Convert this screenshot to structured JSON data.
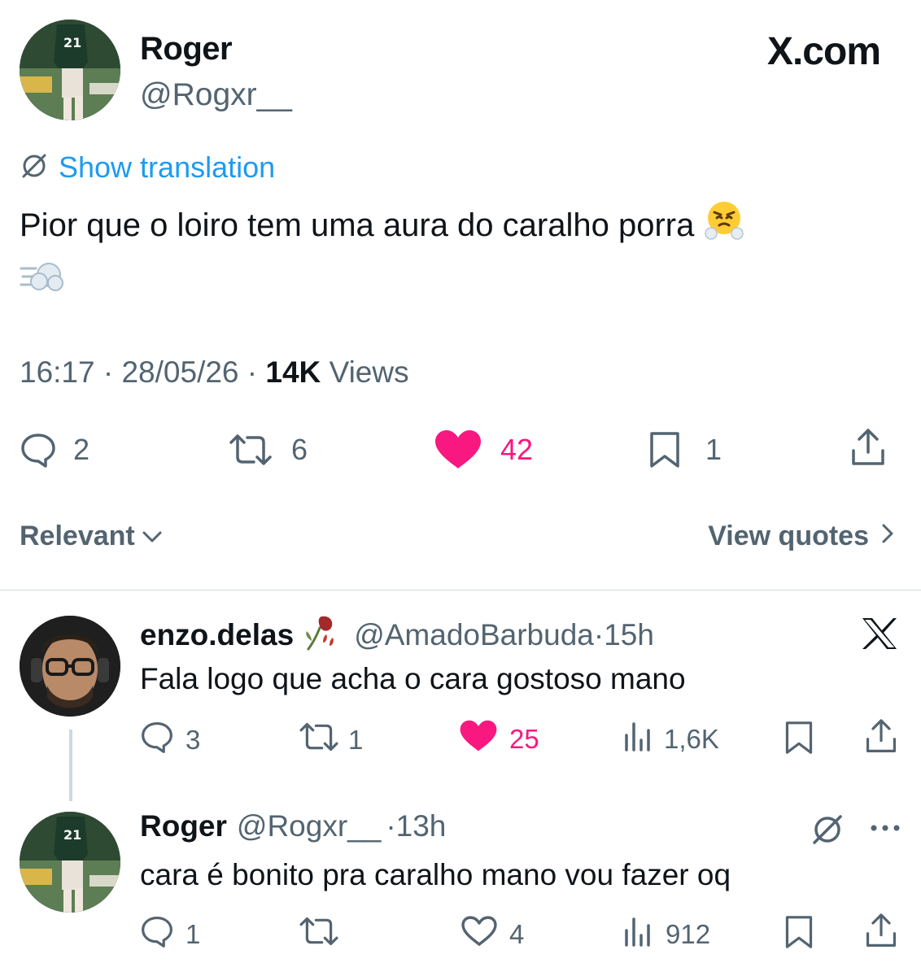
{
  "header": {
    "name": "Roger",
    "handle": "@Rogxr__",
    "brand": "X.com"
  },
  "tweet": {
    "translate_label": "Show translation",
    "text": "Pior que o loiro tem uma aura do caralho porra",
    "emojis": [
      "face-with-steam-from-nose",
      "dashing-away"
    ],
    "time": "16:17",
    "date": "28/05/26",
    "views_count": "14K",
    "views_label": "Views",
    "replies": "2",
    "reposts": "6",
    "likes": "42",
    "bookmarks": "1",
    "liked": true
  },
  "sort": {
    "label": "Relevant",
    "quotes_label": "View quotes"
  },
  "replies": [
    {
      "name": "enzo.delas",
      "badge_emoji": "wilted-flower",
      "handle": "@AmadoBarbuda",
      "time": "15h",
      "text": "Fala logo que acha o cara gostoso mano",
      "reply_count": "3",
      "repost_count": "1",
      "like_count": "25",
      "view_count": "1,6K",
      "liked": true
    },
    {
      "name": "Roger",
      "handle": "@Rogxr__",
      "time": "13h",
      "text": "cara é bonito pra caralho mano vou fazer oq",
      "reply_count": "1",
      "repost_count": "",
      "like_count": "4",
      "view_count": "912",
      "liked": false
    }
  ],
  "colors": {
    "text": "#0f1419",
    "secondary": "#536471",
    "link": "#1d9bf0",
    "like": "#f91880",
    "divider": "#cfd9de"
  }
}
